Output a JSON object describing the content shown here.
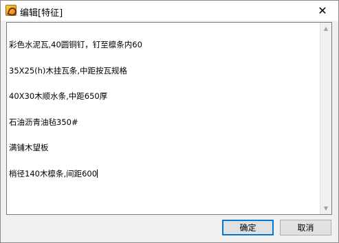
{
  "window": {
    "title": "编辑[特征]",
    "close_glyph": "✕"
  },
  "editor": {
    "lines": [
      "彩色水泥瓦,40圆铜钉，钉至檩条内60",
      "35X25(h)木挂瓦条,中距按瓦规格",
      "40X30木顺水条,中距650厚",
      "石油沥青油毡350#",
      "满铺木望板",
      "梢径140木檩条,间距600"
    ]
  },
  "scrollbar": {
    "up_glyph": "▲",
    "down_glyph": "▼"
  },
  "buttons": {
    "ok_label": "确定",
    "cancel_label": "取消"
  }
}
